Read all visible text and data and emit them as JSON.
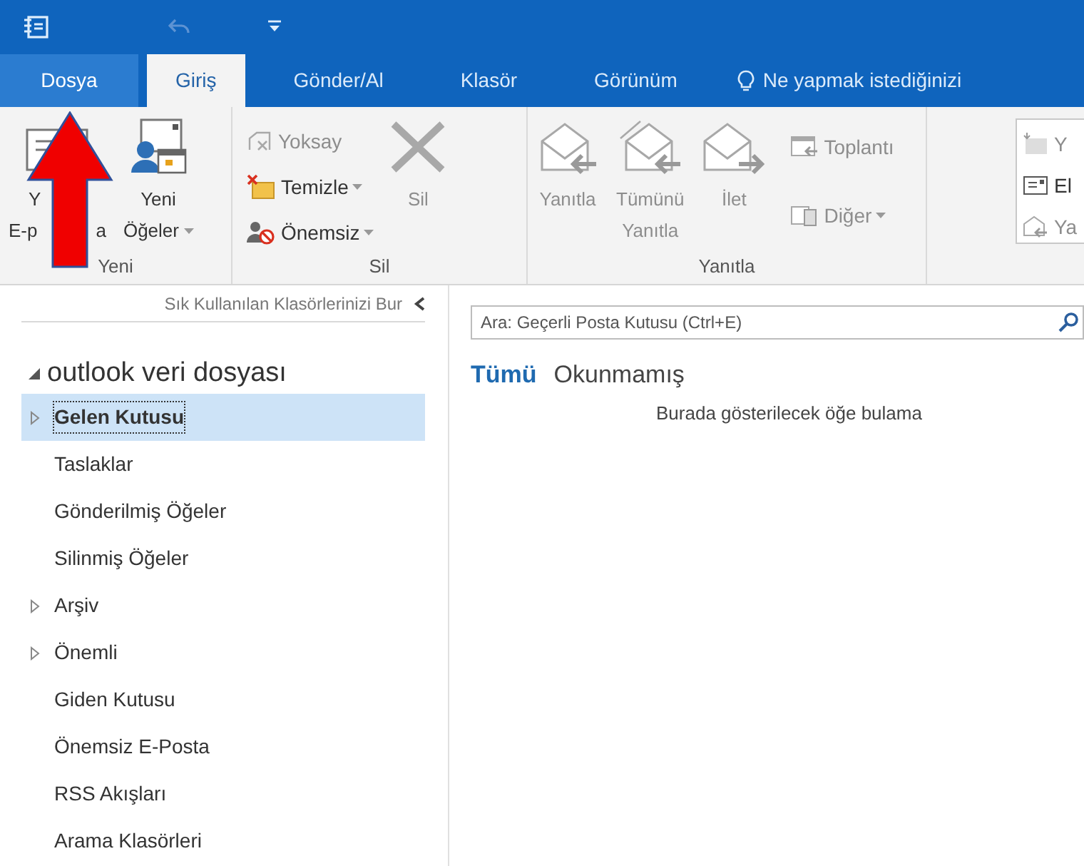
{
  "tabs": [
    {
      "label": "Dosya",
      "kind": "file",
      "selected": false
    },
    {
      "label": "Giriş",
      "kind": "tab",
      "selected": true
    },
    {
      "label": "Gönder/Al",
      "kind": "tab",
      "selected": false
    },
    {
      "label": "Klasör",
      "kind": "tab",
      "selected": false
    },
    {
      "label": "Görünüm",
      "kind": "tab",
      "selected": false
    }
  ],
  "tell_me": "Ne yapmak istediğinizi",
  "ribbon": {
    "groups": [
      {
        "label": "Yeni",
        "columns": [
          {
            "kind": "large",
            "buttons": [
              {
                "kind": "new-mail",
                "lines": [
                  [
                    "Y"
                  ],
                  [
                    "E-p",
                    "a"
                  ]
                ],
                "disabled": false,
                "dropdown": false
              }
            ]
          },
          {
            "kind": "large",
            "buttons": [
              {
                "kind": "new-items",
                "lines": [
                  [
                    "Yeni"
                  ],
                  [
                    "Öğeler"
                  ]
                ],
                "disabled": false,
                "dropdown": true
              }
            ]
          }
        ]
      },
      {
        "label": "Sil",
        "columns": [
          {
            "kind": "small",
            "buttons": [
              {
                "kind": "ignore",
                "lines": [
                  [
                    "Yoksay"
                  ]
                ],
                "disabled": true,
                "dropdown": false
              },
              {
                "kind": "clean",
                "lines": [
                  [
                    "Temizle"
                  ]
                ],
                "disabled": false,
                "dropdown": true
              },
              {
                "kind": "junk",
                "lines": [
                  [
                    "Önemsiz"
                  ]
                ],
                "disabled": false,
                "dropdown": true
              }
            ]
          },
          {
            "kind": "large",
            "buttons": [
              {
                "kind": "delete",
                "lines": [
                  [
                    "Sil"
                  ]
                ],
                "disabled": true,
                "dropdown": false
              }
            ]
          }
        ]
      },
      {
        "label": "Yanıtla",
        "columns": [
          {
            "kind": "large",
            "buttons": [
              {
                "kind": "reply",
                "lines": [
                  [
                    "Yanıtla"
                  ]
                ],
                "disabled": true,
                "dropdown": false
              }
            ]
          },
          {
            "kind": "large",
            "buttons": [
              {
                "kind": "reply-all",
                "lines": [
                  [
                    "Tümünü"
                  ],
                  [
                    "Yanıtla"
                  ]
                ],
                "disabled": true,
                "dropdown": false
              }
            ]
          },
          {
            "kind": "large",
            "buttons": [
              {
                "kind": "forward",
                "lines": [
                  [
                    "İlet"
                  ]
                ],
                "disabled": true,
                "dropdown": false
              }
            ]
          },
          {
            "kind": "small",
            "buttons": [
              {
                "kind": "meeting",
                "lines": [
                  [
                    "Toplantı"
                  ]
                ],
                "disabled": true,
                "dropdown": false
              },
              {
                "kind": "more",
                "lines": [
                  [
                    "Diğer"
                  ]
                ],
                "disabled": true,
                "dropdown": true
              }
            ]
          }
        ]
      },
      {
        "kind": "gallery",
        "columns": [
          {
            "kind": "gallery",
            "buttons": [
              {
                "kind": "move",
                "lines": [
                  [
                    "Y"
                  ]
                ],
                "disabled": true,
                "dropdown": false
              },
              {
                "kind": "mail",
                "lines": [
                  [
                    "El"
                  ]
                ],
                "disabled": false,
                "dropdown": false
              },
              {
                "kind": "reply",
                "lines": [
                  [
                    "Ya"
                  ]
                ],
                "disabled": true,
                "dropdown": false
              }
            ]
          }
        ]
      }
    ]
  },
  "navigation": {
    "favorites_hint": "Sık Kullanılan Klasörlerinizi Bur",
    "account": {
      "name": "outlook veri dosyası",
      "expanded": true
    },
    "folders": [
      {
        "label": "Gelen Kutusu",
        "selected": true,
        "expandable": true
      },
      {
        "label": "Taslaklar",
        "selected": false,
        "expandable": false
      },
      {
        "label": "Gönderilmiş Öğeler",
        "selected": false,
        "expandable": false
      },
      {
        "label": "Silinmiş Öğeler",
        "selected": false,
        "expandable": false
      },
      {
        "label": "Arşiv",
        "selected": false,
        "expandable": true
      },
      {
        "label": "Önemli",
        "selected": false,
        "expandable": true
      },
      {
        "label": "Giden Kutusu",
        "selected": false,
        "expandable": false
      },
      {
        "label": "Önemsiz E-Posta",
        "selected": false,
        "expandable": false
      },
      {
        "label": "RSS Akışları",
        "selected": false,
        "expandable": false
      },
      {
        "label": "Arama Klasörleri",
        "selected": false,
        "expandable": false
      }
    ]
  },
  "mail": {
    "search": {
      "placeholder": "Ara: Geçerli Posta Kutusu (Ctrl+E)"
    },
    "filters": [
      {
        "label": "Tümü",
        "selected": true
      },
      {
        "label": "Okunmamış",
        "selected": false
      }
    ],
    "empty_message": "Burada gösterilecek öğe bulama"
  }
}
